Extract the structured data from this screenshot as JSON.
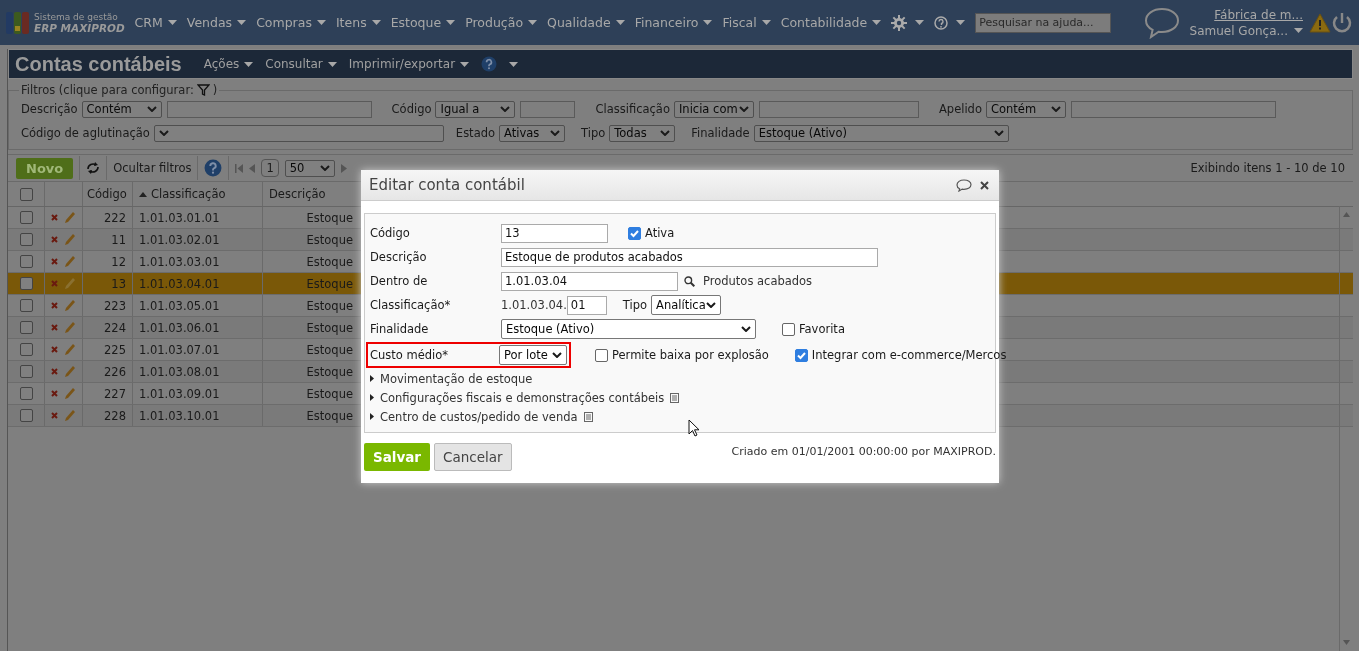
{
  "nav": {
    "logo_line1": "Sistema de gestão",
    "logo_line2": "ERP MAXIPROD",
    "menus": [
      "CRM",
      "Vendas",
      "Compras",
      "Itens",
      "Estoque",
      "Produção",
      "Qualidade",
      "Financeiro",
      "Fiscal",
      "Contabilidade"
    ],
    "search": {
      "placeholder": "Pesquisar na ajuda..."
    },
    "company": "Fábrica de m...",
    "user": "Samuel Gonça..."
  },
  "page": {
    "title": "Contas contábeis",
    "actions": [
      "Ações",
      "Consultar",
      "Imprimir/exportar"
    ]
  },
  "filters": {
    "legend": "Filtros (clique para configurar:",
    "legend_end": ")",
    "rows": [
      [
        {
          "label": "Descrição",
          "operator": "Contém",
          "kind": "op-text"
        },
        {
          "label": "Código",
          "operator": "Igual a",
          "kind": "op-text"
        },
        {
          "label": "Classificação",
          "operator": "Inicia com",
          "kind": "op-text"
        },
        {
          "label": "Apelido",
          "operator": "Contém",
          "kind": "op-text"
        }
      ],
      [
        {
          "label": "Código de aglutinação",
          "kind": "wide-select"
        },
        {
          "label": "Estado",
          "value": "Ativas",
          "kind": "select"
        },
        {
          "label": "Tipo",
          "value": "Todas",
          "kind": "select"
        },
        {
          "label": "Finalidade",
          "value": "Estoque (Ativo)",
          "kind": "long-select"
        }
      ]
    ]
  },
  "toolbar": {
    "new_button": "Novo",
    "hide_filters": "Ocultar filtros",
    "page": "1",
    "page_size": "50",
    "summary": "Exibindo itens 1 - 10 de 10"
  },
  "table": {
    "select_all_checked": false,
    "columns": [
      {
        "label": "Código",
        "sorted": false
      },
      {
        "label": "Classificação",
        "sorted": true
      },
      {
        "label": "Descrição",
        "sorted": false
      }
    ],
    "rows": [
      {
        "code": "222",
        "classification": "1.01.03.01.01",
        "description": "Estoque",
        "checked": false,
        "selected": false
      },
      {
        "code": "11",
        "classification": "1.01.03.02.01",
        "description": "Estoque",
        "checked": false,
        "selected": false
      },
      {
        "code": "12",
        "classification": "1.01.03.03.01",
        "description": "Estoque",
        "checked": false,
        "selected": false
      },
      {
        "code": "13",
        "classification": "1.01.03.04.01",
        "description": "Estoque",
        "checked": false,
        "selected": true
      },
      {
        "code": "223",
        "classification": "1.01.03.05.01",
        "description": "Estoque",
        "checked": false,
        "selected": false
      },
      {
        "code": "224",
        "classification": "1.01.03.06.01",
        "description": "Estoque",
        "checked": false,
        "selected": false
      },
      {
        "code": "225",
        "classification": "1.01.03.07.01",
        "description": "Estoque",
        "checked": false,
        "selected": false
      },
      {
        "code": "226",
        "classification": "1.01.03.08.01",
        "description": "Estoque",
        "checked": false,
        "selected": false
      },
      {
        "code": "227",
        "classification": "1.01.03.09.01",
        "description": "Estoque",
        "checked": false,
        "selected": false
      },
      {
        "code": "228",
        "classification": "1.01.03.10.01",
        "description": "Estoque",
        "checked": false,
        "selected": false
      }
    ]
  },
  "dialog": {
    "title": "Editar conta contábil",
    "codigo": {
      "label": "Código",
      "value": "13"
    },
    "ativa": {
      "label": "Ativa",
      "checked": true
    },
    "descricao": {
      "label": "Descrição",
      "value": "Estoque de produtos acabados"
    },
    "dentro_de": {
      "label": "Dentro de",
      "value": "1.01.03.04",
      "lookup": "Produtos acabados"
    },
    "classificacao": {
      "label": "Classificação*",
      "prefix": "1.01.03.04.",
      "value": "01"
    },
    "tipo": {
      "label": "Tipo",
      "value": "Analítica"
    },
    "finalidade": {
      "label": "Finalidade",
      "value": "Estoque (Ativo)"
    },
    "favorita": {
      "label": "Favorita",
      "checked": false
    },
    "custo_medio": {
      "label": "Custo médio*",
      "value": "Por lote",
      "highlighted": true
    },
    "permite_baixa": {
      "label": "Permite baixa por explosão",
      "checked": false
    },
    "integrar": {
      "label": "Integrar com e-commerce/Mercos",
      "checked": true
    },
    "sections": [
      {
        "label": "Movimentação de estoque",
        "has_note": false
      },
      {
        "label": "Configurações fiscais e demonstrações contábeis",
        "has_note": true
      },
      {
        "label": "Centro de custos/pedido de venda",
        "has_note": true
      }
    ],
    "save": "Salvar",
    "cancel": "Cancelar",
    "footer": "Criado em 01/01/2001 00:00:00 por MAXIPROD."
  }
}
